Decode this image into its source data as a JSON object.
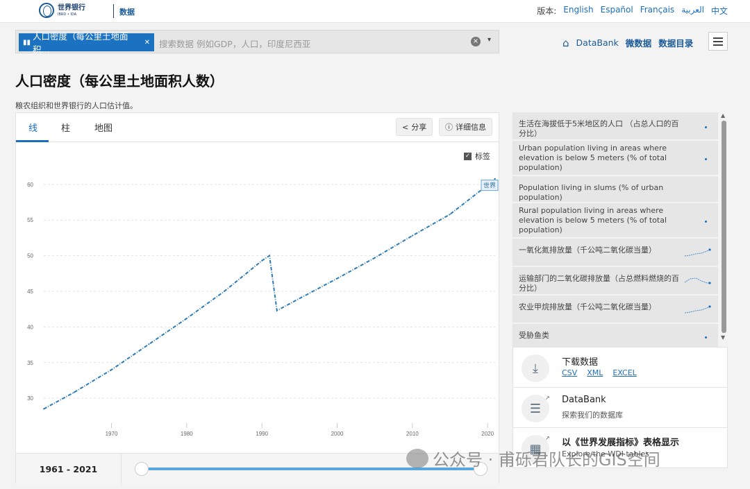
{
  "header": {
    "logo_line1": "世界银行",
    "logo_line2": "IBRD • IDA",
    "section": "数据",
    "lang_label": "版本:",
    "languages": [
      "English",
      "Español",
      "Français",
      "العربية",
      "中文"
    ]
  },
  "search": {
    "chip_label": "人口密度（每公里土地面积...",
    "placeholder": "搜索数据 例如GDP，人口，印度尼西亚",
    "clear_icon": "×",
    "dropdown_icon": "▾"
  },
  "nav": {
    "home_icon": "⌂",
    "databank": "DataBank",
    "micro": "微数据",
    "catalog": "数据目录"
  },
  "page": {
    "title": "人口密度（每公里土地面积人数）",
    "source": "粮农组织和世界银行的人口估计值。"
  },
  "chart_tabs": {
    "line": "线",
    "bar": "柱",
    "map": "地图",
    "share": "分享",
    "details": "详细信息",
    "labels_toggle": "标签"
  },
  "chart_data": {
    "type": "line",
    "series": [
      {
        "name": "世界",
        "x": [
          1961,
          1965,
          1970,
          1975,
          1980,
          1985,
          1990,
          1991,
          1992,
          1995,
          2000,
          2005,
          2010,
          2015,
          2020,
          2021
        ],
        "y": [
          28.5,
          30.8,
          34.0,
          37.6,
          41.2,
          45.0,
          49.3,
          50.0,
          42.3,
          44.0,
          46.8,
          49.7,
          52.8,
          55.8,
          59.9,
          60.8
        ]
      }
    ],
    "x_ticks": [
      "1970",
      "1980",
      "1990",
      "2000",
      "2010",
      "2020"
    ],
    "y_ticks": [
      "30",
      "35",
      "40",
      "45",
      "50",
      "55",
      "60"
    ],
    "xlim": [
      1961,
      2021
    ],
    "ylim": [
      27,
      63
    ],
    "grid": true,
    "color": "#2b7bb9"
  },
  "range": {
    "label": "1961 - 2021"
  },
  "related": [
    {
      "label": "生活在海拔低于5米地区的人口 （占总人口的百分比）",
      "spark": "dot"
    },
    {
      "label": "Urban population living in areas where elevation is below 5 meters (% of total population)",
      "spark": "dot"
    },
    {
      "label": "Population living in slums (% of urban population)",
      "spark": "none"
    },
    {
      "label": "Rural population living in areas where elevation is below 5 meters (% of total population)",
      "spark": "dot"
    },
    {
      "label": "一氧化氮排放量（千公吨二氧化碳当量）",
      "spark": "rising"
    },
    {
      "label": "运输部门的二氧化碳排放量（占总燃料燃烧的百分比）",
      "spark": "hump"
    },
    {
      "label": "农业甲烷排放量（千公吨二氧化碳当量）",
      "spark": "rising"
    },
    {
      "label": "受胁鱼类",
      "spark": "dot"
    }
  ],
  "downloads": {
    "title": "下载数据",
    "links": [
      "CSV",
      "XML",
      "EXCEL"
    ],
    "databank_title": "DataBank",
    "databank_sub": "探索我们的数据库",
    "wdi_title": "以《世界发展指标》表格显示",
    "wdi_sub": "Explore the WDI tables"
  },
  "watermark": {
    "text": "公众号 · 甫砾君队长的GIS空间"
  },
  "colors": {
    "accent": "#1a6ec0",
    "line": "#2b7bb9"
  }
}
